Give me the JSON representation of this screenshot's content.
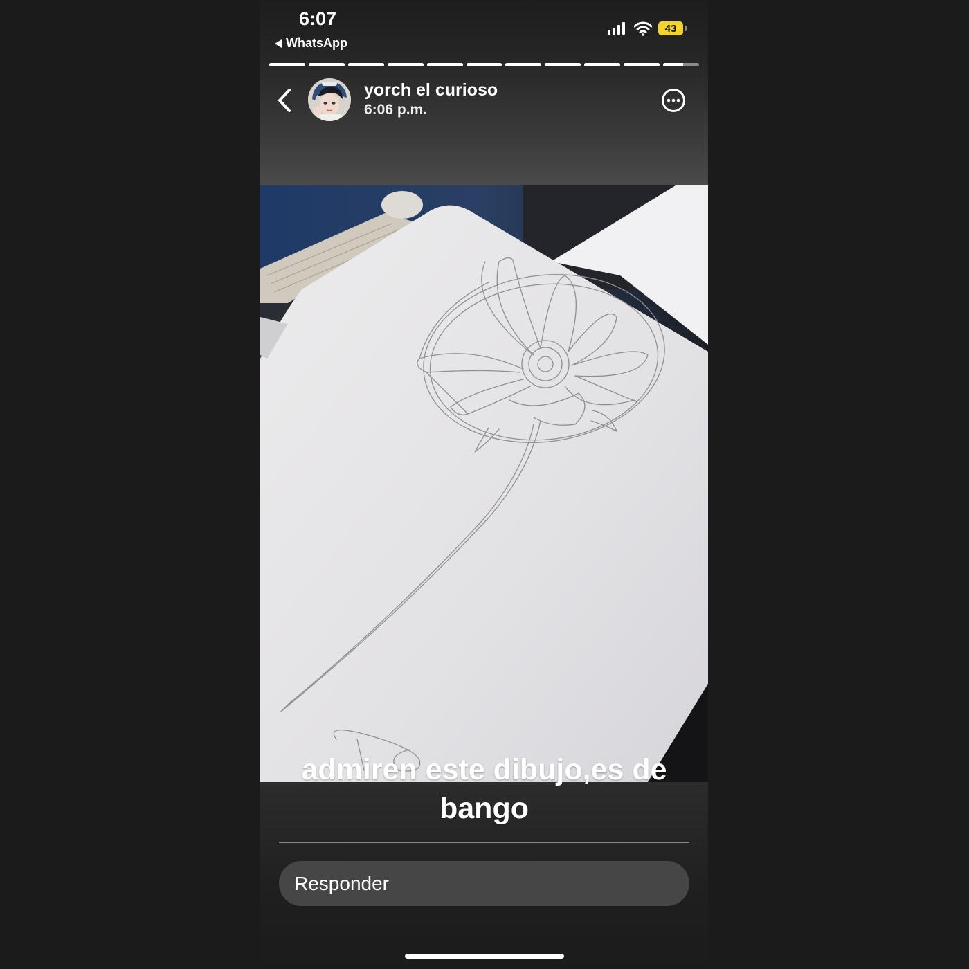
{
  "status_bar": {
    "time": "6:07",
    "back_app": "WhatsApp",
    "battery": "43"
  },
  "story": {
    "segments_total": 11,
    "segments_complete": 10,
    "current_segment_progress": 0.55,
    "contact_name": "yorch el curioso",
    "posted_time": "6:06 p.m.",
    "caption": "admiren este dibujo,es de bango"
  },
  "reply": {
    "placeholder": "Responder"
  },
  "icons": {
    "back": "chevron-left-icon",
    "more": "more-options-icon",
    "signal": "cellular-signal-icon",
    "wifi": "wifi-icon",
    "battery": "battery-icon"
  },
  "colors": {
    "battery": "#f4d32c",
    "background": "#1c1b1b"
  }
}
